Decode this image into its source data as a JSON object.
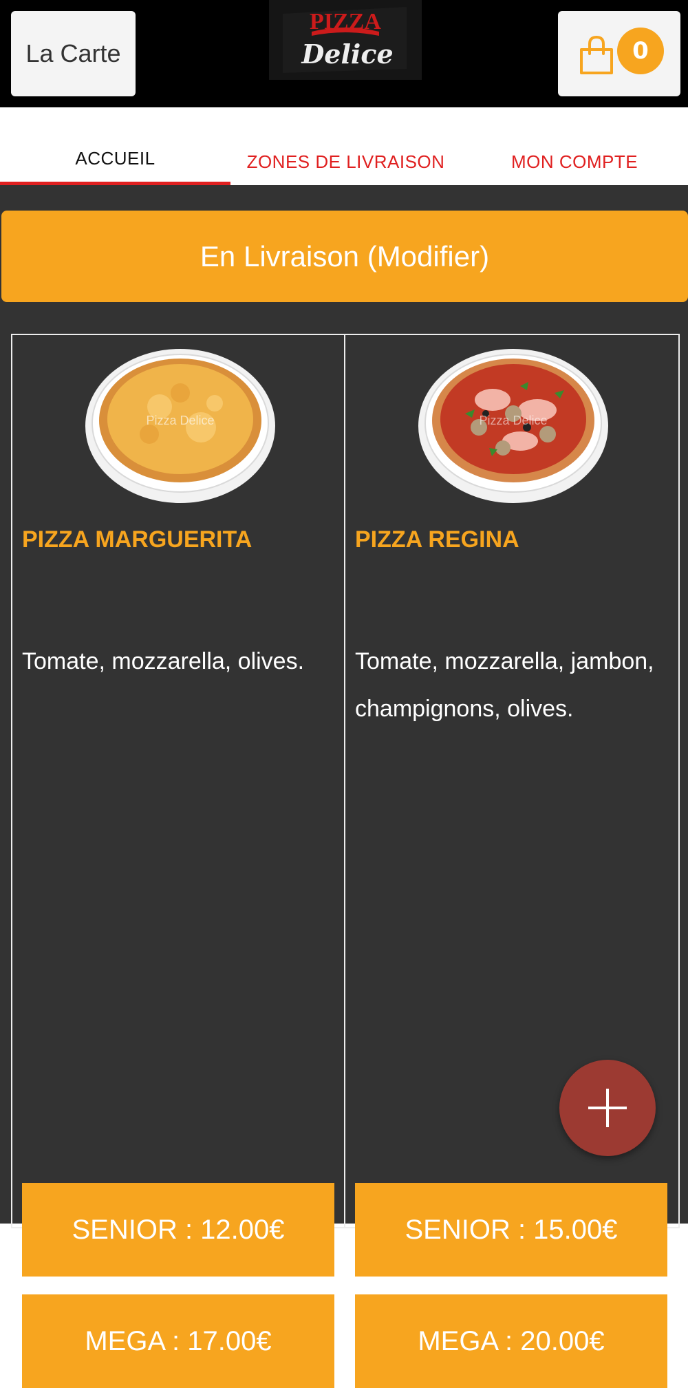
{
  "header": {
    "menu_label": "La Carte",
    "logo_text_top": "PIZZA",
    "logo_text_bottom": "Delice",
    "cart_count": "0"
  },
  "tabs": [
    {
      "label": "ACCUEIL"
    },
    {
      "label": "ZONES DE LIVRAISON"
    },
    {
      "label": "MON COMPTE"
    }
  ],
  "mode_banner": "En Livraison (Modifier)",
  "products": [
    {
      "title": "PIZZA MARGUERITA",
      "description": "Tomate, mozzarella, olives.",
      "image_watermark": "Pizza Delice",
      "prices": [
        {
          "label": "SENIOR : 12.00€"
        },
        {
          "label": "MEGA : 17.00€"
        }
      ]
    },
    {
      "title": "PIZZA REGINA",
      "description": "Tomate, mozzarella, jambon, champignons, olives.",
      "image_watermark": "Pizza Delice",
      "prices": [
        {
          "label": "SENIOR : 15.00€"
        },
        {
          "label": "MEGA : 20.00€"
        }
      ]
    }
  ],
  "colors": {
    "accent": "#f7a51f",
    "tab_active_underline": "#e02020",
    "tab_text": "#e02020",
    "background_dark": "#333333",
    "fab": "#9c3a32"
  },
  "icons": {
    "cart": "shopping-bag-icon",
    "fab": "plus-icon"
  }
}
